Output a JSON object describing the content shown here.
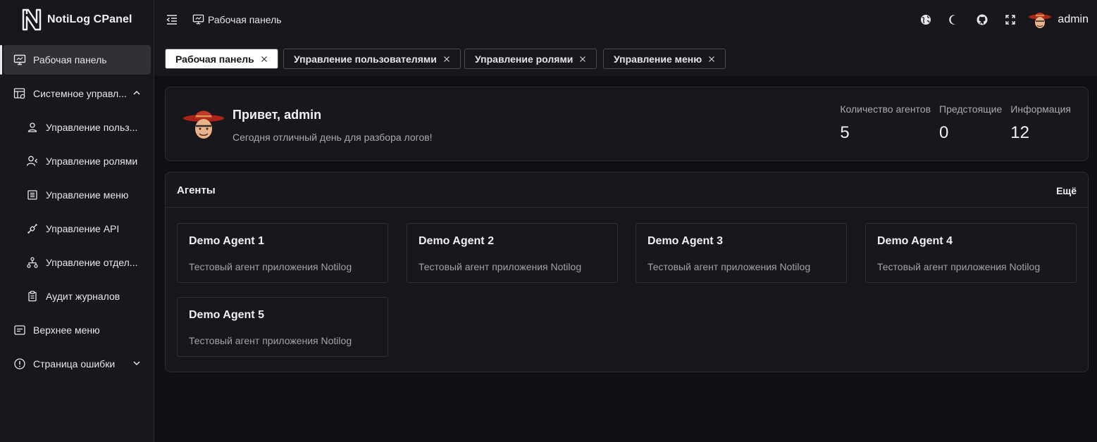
{
  "app": {
    "title": "NotiLog CPanel"
  },
  "sidebar": {
    "items": [
      {
        "label": "Рабочая панель",
        "icon": "monitor-icon"
      },
      {
        "label": "Системное управл...",
        "icon": "system-settings-icon"
      },
      {
        "label": "Управление польз...",
        "icon": "user-icon"
      },
      {
        "label": "Управление ролями",
        "icon": "role-icon"
      },
      {
        "label": "Управление меню",
        "icon": "menu-list-icon"
      },
      {
        "label": "Управление API",
        "icon": "api-icon"
      },
      {
        "label": "Управление отдел...",
        "icon": "department-icon"
      },
      {
        "label": "Аудит журналов",
        "icon": "clipboard-icon"
      },
      {
        "label": "Верхнее меню",
        "icon": "top-menu-icon"
      },
      {
        "label": "Страница ошибки",
        "icon": "error-icon"
      }
    ]
  },
  "header": {
    "breadcrumb": "Рабочая панель",
    "icons": [
      "globe-icon",
      "moon-icon",
      "github-icon",
      "fullscreen-icon"
    ],
    "username": "admin"
  },
  "tabs": [
    {
      "label": "Рабочая панель",
      "active": true
    },
    {
      "label": "Управление пользователями",
      "active": false
    },
    {
      "label": "Управление ролями",
      "active": false
    },
    {
      "label": "Управление меню",
      "active": false
    }
  ],
  "welcome": {
    "greeting": "Привет, admin",
    "subtitle": "Сегодня отличный день для разбора логов!",
    "stats": [
      {
        "label": "Количество агентов",
        "value": "5"
      },
      {
        "label": "Предстоящие",
        "value": "0"
      },
      {
        "label": "Информация",
        "value": "12"
      }
    ]
  },
  "agents": {
    "title": "Агенты",
    "more": "Ещё",
    "items": [
      {
        "name": "Demo Agent 1",
        "desc": "Тестовый агент приложения Notilog"
      },
      {
        "name": "Demo Agent 2",
        "desc": "Тестовый агент приложения Notilog"
      },
      {
        "name": "Demo Agent 3",
        "desc": "Тестовый агент приложения Notilog"
      },
      {
        "name": "Demo Agent 4",
        "desc": "Тестовый агент приложения Notilog"
      },
      {
        "name": "Demo Agent 5",
        "desc": "Тестовый агент приложения Notilog"
      }
    ]
  },
  "colors": {
    "background": "#101014",
    "panel": "#18181c",
    "active_item": "#303035",
    "border": "#2c2c30"
  }
}
